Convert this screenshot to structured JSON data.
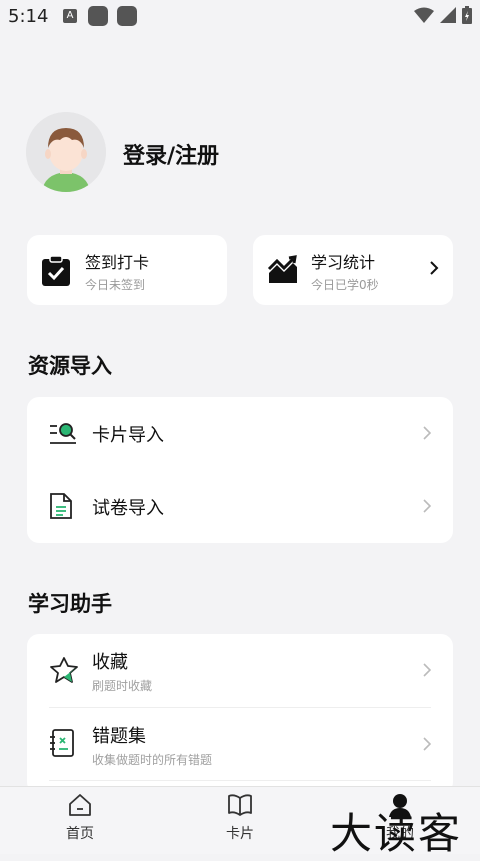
{
  "status_bar": {
    "time": "5:14",
    "a_icon": "A"
  },
  "profile": {
    "login_label": "登录/注册"
  },
  "quick": {
    "checkin": {
      "title": "签到打卡",
      "sub": "今日未签到"
    },
    "stats": {
      "title": "学习统计",
      "sub": "今日已学0秒"
    }
  },
  "resource": {
    "title": "资源导入",
    "items": [
      {
        "label": "卡片导入",
        "icon": "card-search-icon"
      },
      {
        "label": "试卷导入",
        "icon": "document-icon"
      }
    ]
  },
  "assistant": {
    "title": "学习助手",
    "items": [
      {
        "label": "收藏",
        "sub": "刷题时收藏",
        "icon": "star-icon"
      },
      {
        "label": "错题集",
        "sub": "收集做题时的所有错题",
        "icon": "wrong-book-icon"
      }
    ]
  },
  "nav": {
    "items": [
      {
        "label": "首页",
        "icon": "home-icon"
      },
      {
        "label": "卡片",
        "icon": "book-icon"
      },
      {
        "label": "我的",
        "icon": "person-icon"
      }
    ]
  },
  "watermark": "大读客",
  "colors": {
    "accent": "#16b36b",
    "background": "#f3f3f5"
  }
}
